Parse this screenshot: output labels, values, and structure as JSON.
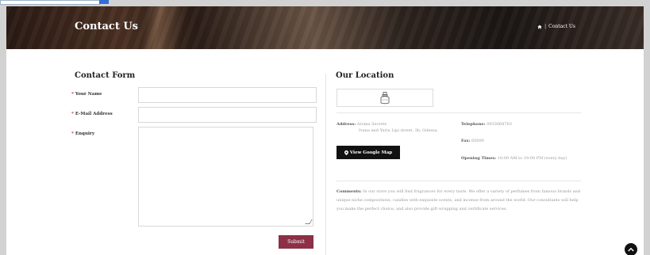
{
  "banner": {
    "title": "Contact Us",
    "breadcrumb_current": "Contact Us",
    "breadcrumb_separator": "|"
  },
  "contact_form": {
    "title": "Contact Form",
    "required_mark": "*",
    "fields": {
      "name_label": "Your Name",
      "email_label": "E-Mail Address",
      "enquiry_label": "Enquiry"
    },
    "submit_label": "Submit"
  },
  "location": {
    "title": "Our Location",
    "address_label": "Address:",
    "address_line1": "Aroma Secrets",
    "address_line2": "Ivana and Yuria Lipi street, 3b, Odessa,",
    "telephone_label": "Telephone:",
    "telephone_value": "0933668763",
    "fax_label": "Fax:",
    "fax_value": "65000",
    "map_button_label": "View Google Map",
    "opening_label": "Opening Times:",
    "opening_value": "10:00 AM to 19:00 PM (every day)",
    "comments_label": "Comments:",
    "comments_text": "In our store you will find fragrances for every taste. We offer a variety of perfumes from famous brands and unique niche compositions, candles with exquisite scents, and incense from around the world. Our consultants will help you make the perfect choice, and also provide gift wrapping and certificate services."
  },
  "colors": {
    "accent": "#8d2f46",
    "map_button": "#111111",
    "required": "#c0392b"
  }
}
